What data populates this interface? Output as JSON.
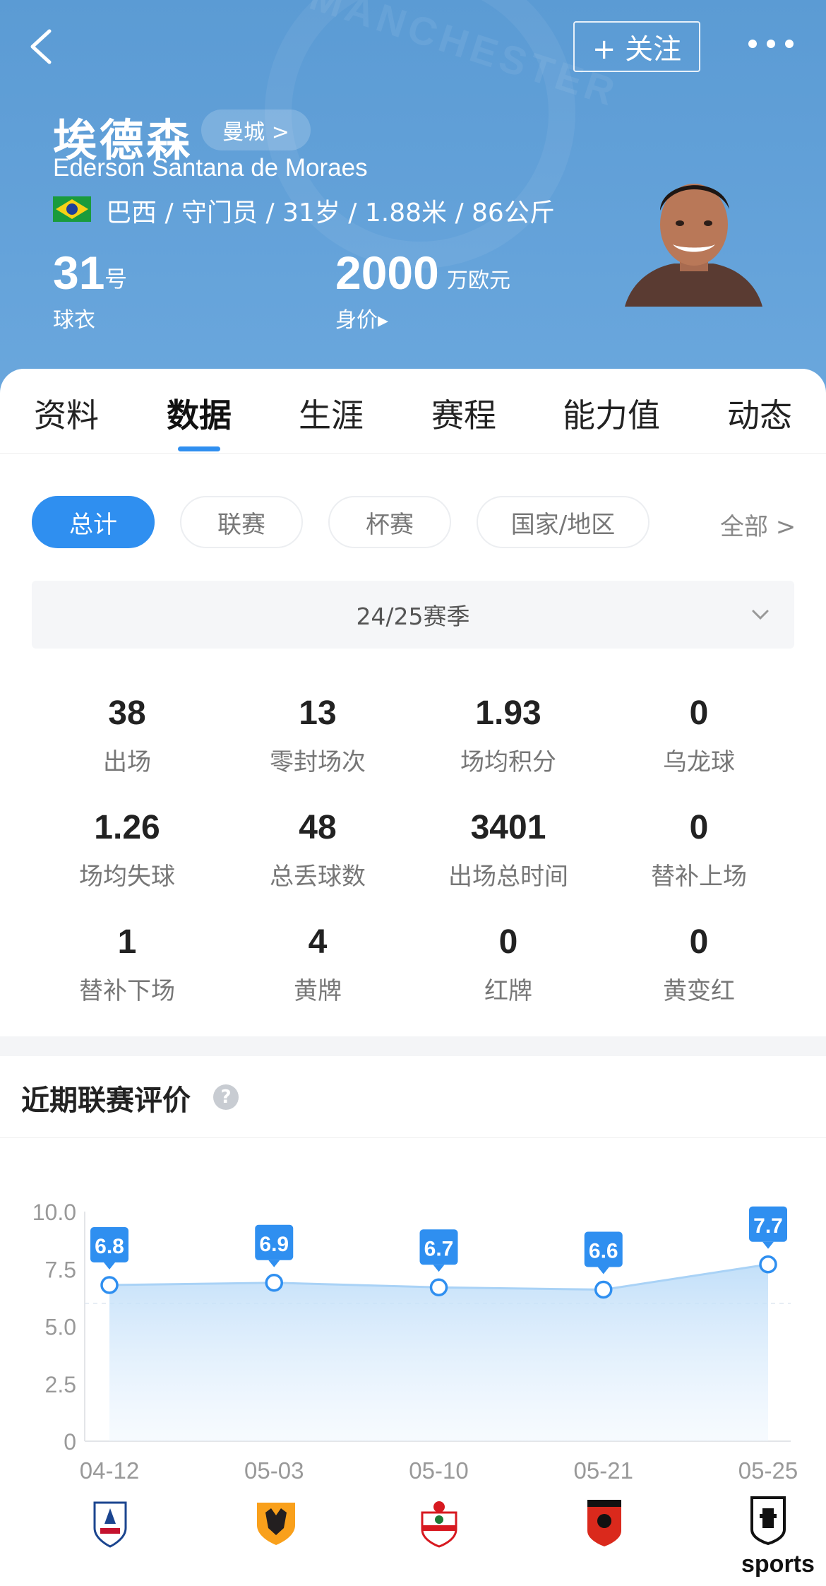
{
  "header": {
    "follow_label": "+ 关注",
    "name_cn": "埃德森",
    "club_label": "曼城 >",
    "name_en": "Ederson Santana de Moraes",
    "bio": "巴西 / 守门员 / 31岁 / 1.88米 / 86公斤",
    "jersey_number": "31",
    "jersey_unit": "号",
    "jersey_label": "球衣",
    "market_value": "2000",
    "market_value_unit": "万欧元",
    "market_value_label": "身价▸",
    "watermark": "MANCHESTER",
    "accent_color": "#5b9bd4"
  },
  "tabs": [
    {
      "label": "资料"
    },
    {
      "label": "数据",
      "active": true
    },
    {
      "label": "生涯"
    },
    {
      "label": "赛程"
    },
    {
      "label": "能力值"
    },
    {
      "label": "动态"
    }
  ],
  "filters": {
    "chips": [
      {
        "label": "总计",
        "active": true
      },
      {
        "label": "联赛"
      },
      {
        "label": "杯赛"
      },
      {
        "label": "国家/地区"
      }
    ],
    "all_label": "全部 >",
    "season": "24/25赛季"
  },
  "stats": [
    {
      "value": "38",
      "label": "出场"
    },
    {
      "value": "13",
      "label": "零封场次"
    },
    {
      "value": "1.93",
      "label": "场均积分"
    },
    {
      "value": "0",
      "label": "乌龙球"
    },
    {
      "value": "1.26",
      "label": "场均失球"
    },
    {
      "value": "48",
      "label": "总丢球数"
    },
    {
      "value": "3401",
      "label": "出场总时间"
    },
    {
      "value": "0",
      "label": "替补上场"
    },
    {
      "value": "1",
      "label": "替补下场"
    },
    {
      "value": "4",
      "label": "黄牌"
    },
    {
      "value": "0",
      "label": "红牌"
    },
    {
      "value": "0",
      "label": "黄变红"
    }
  ],
  "chart_section": {
    "title": "近期联赛评价",
    "help_glyph": "?",
    "opponents": [
      "crystal-palace-badge",
      "wolves-badge",
      "southampton-badge",
      "bournemouth-badge",
      "fulham-badge"
    ],
    "watermark": "sports"
  },
  "chart_data": {
    "type": "area",
    "x": [
      "04-12",
      "05-03",
      "05-10",
      "05-21",
      "05-25"
    ],
    "values": [
      6.8,
      6.9,
      6.7,
      6.6,
      7.7
    ],
    "yticks": [
      "10.0",
      "7.5",
      "5.0",
      "2.5",
      "0"
    ],
    "ylim": [
      0,
      10
    ],
    "line_color": "#2f8ff0",
    "reference_line": 6,
    "grid": false
  }
}
